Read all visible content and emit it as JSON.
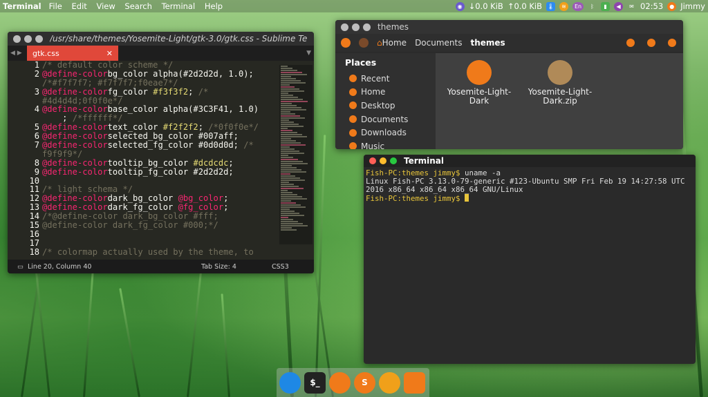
{
  "topbar": {
    "app_name": "Terminal",
    "menus": [
      "File",
      "Edit",
      "View",
      "Search",
      "Terminal",
      "Help"
    ],
    "net_down": "↓0.0 KiB",
    "net_up": "↑0.0 KiB",
    "lang": "En",
    "time": "02:53",
    "user": "Jimmy",
    "colors": {
      "accent": "#f07a1a"
    }
  },
  "sublime": {
    "title": "/usr/share/themes/Yosemite-Light/gtk-3.0/gtk.css - Sublime Te",
    "tab_label": "gtk.css",
    "tab_close": "✕",
    "line_numbers": [
      "1",
      "2",
      "",
      "3",
      "",
      "4",
      "",
      "5",
      "6",
      "7",
      "",
      "8",
      "9",
      "10",
      "11",
      "12",
      "13",
      "14",
      "15",
      "16",
      "17",
      "18"
    ],
    "status_position": "Line 20, Column 40",
    "status_tabsize": "Tab Size: 4",
    "status_syntax": "CSS3"
  },
  "filemanager": {
    "title": "themes",
    "crumbs": [
      "Home",
      "Documents",
      "themes"
    ],
    "places_header": "Places",
    "places": [
      "Recent",
      "Home",
      "Desktop",
      "Documents",
      "Downloads",
      "Music"
    ],
    "files": [
      {
        "name": "Yosemite-Light-Dark",
        "icon": "folder-icon"
      },
      {
        "name": "Yosemite-Light-Dark.zip",
        "icon": "zip-archive-icon"
      }
    ]
  },
  "terminal": {
    "title": "Terminal",
    "prompt": "Fish-PC:themes jimmy$",
    "command": " uname -a",
    "output": "Linux Fish-PC 3.13.0-79-generic #123-Ubuntu SMP Fri Feb 19 14:27:58 UTC 2016 x86_64 x86_64 x86_64 GNU/Linux",
    "prompt2": "Fish-PC:themes jimmy$"
  },
  "dock": {
    "items": [
      "finder-icon",
      "terminal-icon",
      "files-icon",
      "sublime-icon",
      "fire-icon",
      "notes-icon"
    ],
    "labels": [
      "",
      "$_",
      "",
      "S",
      "",
      ""
    ]
  }
}
